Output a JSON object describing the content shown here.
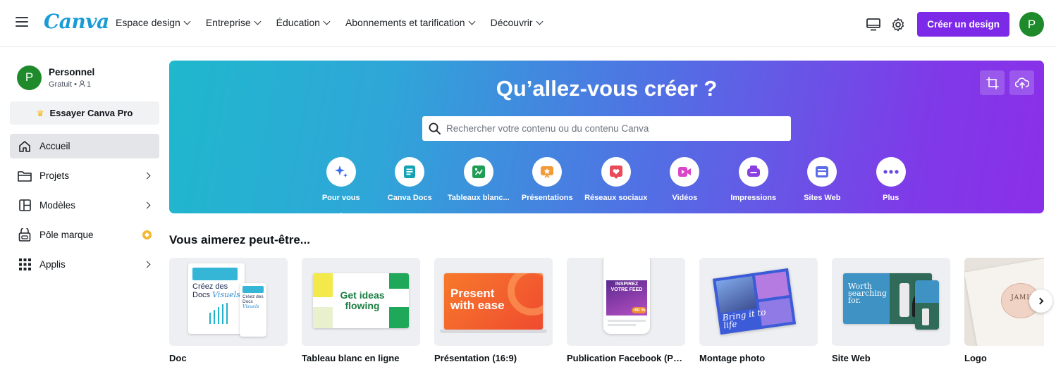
{
  "header": {
    "logo": "Canva",
    "nav": [
      {
        "label": "Espace design"
      },
      {
        "label": "Entreprise"
      },
      {
        "label": "Éducation"
      },
      {
        "label": "Abonnements et tarification"
      },
      {
        "label": "Découvrir"
      }
    ],
    "create_label": "Créer un design",
    "avatar_initial": "P",
    "icons": [
      "desktop-icon",
      "gear-icon"
    ]
  },
  "sidebar": {
    "profile": {
      "initial": "P",
      "name": "Personnel",
      "plan": "Gratuit • ",
      "members": "1"
    },
    "try_pro": "Essayer Canva Pro",
    "items": [
      {
        "label": "Accueil",
        "icon": "home-icon",
        "active": true
      },
      {
        "label": "Projets",
        "icon": "folder-icon"
      },
      {
        "label": "Modèles",
        "icon": "templates-icon"
      },
      {
        "label": "Pôle marque",
        "icon": "brand-icon"
      },
      {
        "label": "Applis",
        "icon": "apps-grid-icon"
      }
    ]
  },
  "hero": {
    "title": "Qu’allez-vous créer ?",
    "search_placeholder": "Rechercher votre contenu ou du contenu Canva",
    "categories": [
      {
        "label": "Pour vous",
        "icon": "sparkle-icon",
        "color": "#3b82f6"
      },
      {
        "label": "Canva Docs",
        "icon": "doc-icon",
        "color": "#13a3b5"
      },
      {
        "label": "Tableaux blanc...",
        "icon": "whiteboard-icon",
        "color": "#1f9d55"
      },
      {
        "label": "Présentations",
        "icon": "presentation-icon",
        "color": "#f29b38"
      },
      {
        "label": "Réseaux sociaux",
        "icon": "heart-icon",
        "color": "#e94b5b"
      },
      {
        "label": "Vidéos",
        "icon": "video-icon",
        "color": "#d946c8"
      },
      {
        "label": "Impressions",
        "icon": "print-icon",
        "color": "#8b3fe0"
      },
      {
        "label": "Sites Web",
        "icon": "website-icon",
        "color": "#5c6ce6"
      },
      {
        "label": "Plus",
        "icon": "more-icon",
        "color": "#6a46e0"
      }
    ]
  },
  "suggestions": {
    "title": "Vous aimerez peut-être...",
    "items": [
      {
        "label": "Doc"
      },
      {
        "label": "Tableau blanc en ligne"
      },
      {
        "label": "Présentation (16:9)"
      },
      {
        "label": "Publication Facebook (Paysage)"
      },
      {
        "label": "Montage photo"
      },
      {
        "label": "Site Web"
      },
      {
        "label": "Logo"
      }
    ],
    "thumb_text": {
      "doc_main": "Créez des Docs",
      "doc_italic": "Visuels",
      "doc_small": "Créez des Docs",
      "doc_small_italic": "Visuels",
      "wb": "Get ideas flowing",
      "pres": "Present with ease",
      "fb_line1": "INSPIREZ",
      "fb_line2": "VOTRE FEED",
      "fb_pct": "-60 %",
      "photo": "Bring it to life",
      "web": "Worth searching for.",
      "logo": "JAMIL"
    }
  }
}
